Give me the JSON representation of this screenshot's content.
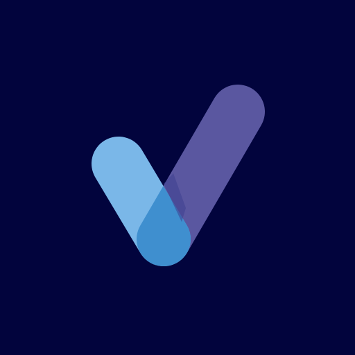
{
  "background_color": "#02043d",
  "logo": {
    "icon": "checkmark-logo-icon",
    "colors": {
      "right_stroke": "#5a57a0",
      "left_stroke": "#7ab7e8",
      "overlap": "#3f8fcf",
      "overlap_shadow": "#3e3f8f"
    }
  }
}
